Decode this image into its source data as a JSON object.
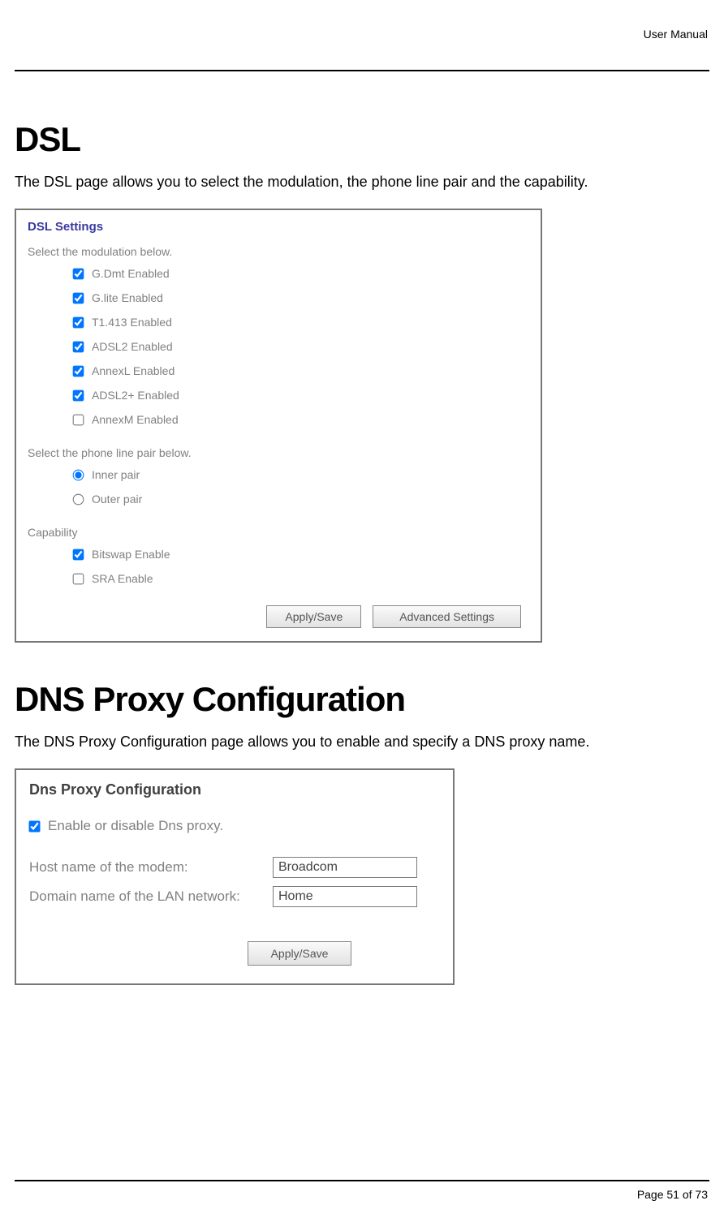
{
  "header": {
    "doc_title": "User Manual"
  },
  "footer": {
    "page_label": "Page 51 of 73"
  },
  "dsl": {
    "heading": "DSL",
    "intro": "The DSL page allows you to select the modulation, the phone line pair and the capability.",
    "panel_title": "DSL Settings",
    "modulation_label": "Select the modulation below.",
    "modulations": [
      {
        "label": "G.Dmt Enabled",
        "checked": true
      },
      {
        "label": "G.lite Enabled",
        "checked": true
      },
      {
        "label": "T1.413 Enabled",
        "checked": true
      },
      {
        "label": "ADSL2 Enabled",
        "checked": true
      },
      {
        "label": "AnnexL Enabled",
        "checked": true
      },
      {
        "label": "ADSL2+ Enabled",
        "checked": true
      },
      {
        "label": "AnnexM Enabled",
        "checked": false
      }
    ],
    "linepair_label": "Select the phone line pair below.",
    "linepairs": [
      {
        "label": "Inner pair",
        "checked": true
      },
      {
        "label": "Outer pair",
        "checked": false
      }
    ],
    "capability_label": "Capability",
    "capabilities": [
      {
        "label": "Bitswap Enable",
        "checked": true
      },
      {
        "label": "SRA Enable",
        "checked": false
      }
    ],
    "buttons": {
      "apply": "Apply/Save",
      "advanced": "Advanced Settings"
    }
  },
  "dns": {
    "heading": "DNS Proxy Configuration",
    "intro": "The DNS Proxy Configuration page allows you to enable and specify a DNS proxy name.",
    "panel_title": "Dns Proxy Configuration",
    "enable_label": "Enable or disable Dns proxy.",
    "enable_checked": true,
    "host_label": "Host name of the modem:",
    "host_value": "Broadcom",
    "domain_label": "Domain name of the LAN network:",
    "domain_value": "Home",
    "buttons": {
      "apply": "Apply/Save"
    }
  }
}
